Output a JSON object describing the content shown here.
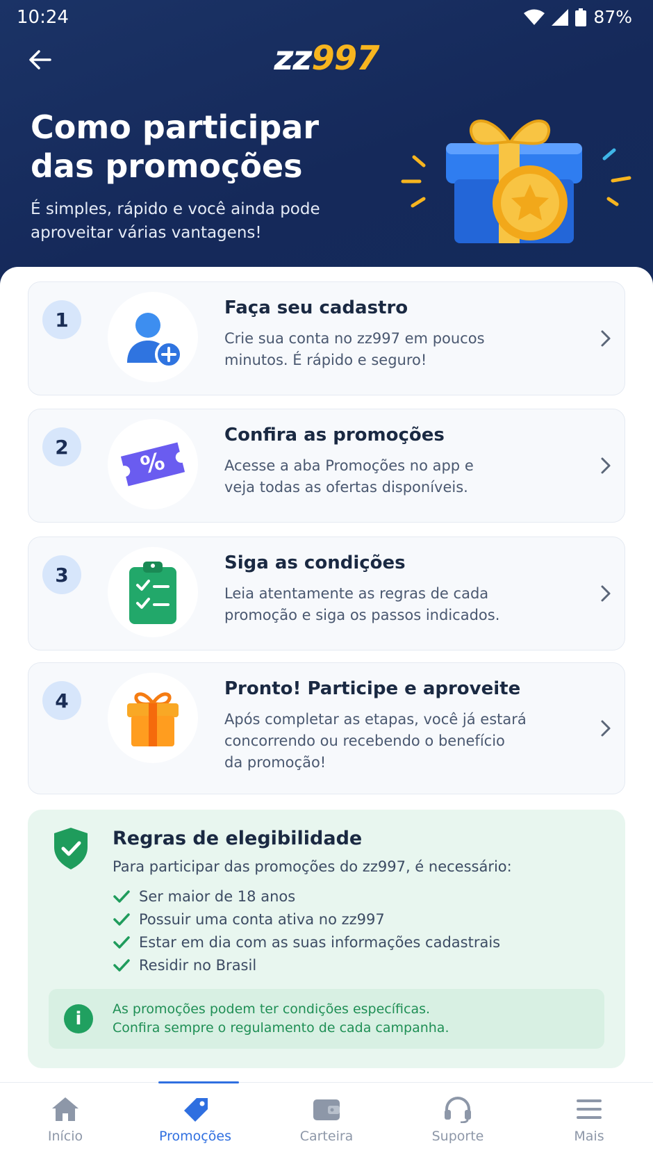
{
  "status_bar": {
    "time": "10:24",
    "battery": "87%"
  },
  "header": {
    "logo_part1": "zz",
    "logo_part2": "997"
  },
  "hero": {
    "title_line1": "Como participar",
    "title_line2": "das promoções",
    "subtitle_line1": "É simples, rápido e você ainda pode",
    "subtitle_line2": "aproveitar várias vantagens!"
  },
  "steps": [
    {
      "number": "1",
      "title": "Faça seu cadastro",
      "desc": [
        "Crie sua conta no zz997 em poucos",
        "minutos. É rápido e seguro!"
      ],
      "icon": "user-add-icon"
    },
    {
      "number": "2",
      "title": "Confira as promoções",
      "desc": [
        "Acesse a aba Promoções no app e",
        "veja todas as ofertas disponíveis."
      ],
      "icon": "ticket-percent-icon"
    },
    {
      "number": "3",
      "title": "Siga as condições",
      "desc": [
        "Leia atentamente as regras de cada",
        "promoção e siga os passos indicados."
      ],
      "icon": "clipboard-check-icon"
    },
    {
      "number": "4",
      "title": "Pronto! Participe e aproveite",
      "desc": [
        "Após completar as etapas, você já estará",
        "concorrendo ou recebendo o benefício",
        "da promoção!"
      ],
      "icon": "gift-icon"
    }
  ],
  "rules": {
    "title": "Regras de elegibilidade",
    "subtitle": "Para participar das promoções do zz997, é necessário:",
    "items": [
      "Ser maior de 18 anos",
      "Possuir uma conta ativa no zz997",
      "Estar em dia com as suas informações cadastrais",
      "Residir no Brasil"
    ],
    "note_line1": "As promoções podem ter condições específicas.",
    "note_line2": "Confira sempre o regulamento de cada campanha."
  },
  "bottom_nav": {
    "items": [
      {
        "label": "Início",
        "icon": "home-icon",
        "active": false
      },
      {
        "label": "Promoções",
        "icon": "tag-icon",
        "active": true
      },
      {
        "label": "Carteira",
        "icon": "wallet-icon",
        "active": false
      },
      {
        "label": "Suporte",
        "icon": "headset-icon",
        "active": false
      },
      {
        "label": "Mais",
        "icon": "menu-icon",
        "active": false
      }
    ]
  },
  "colors": {
    "hero_bg": "#15295a",
    "accent": "#2f6fe0",
    "logo_gold": "#f7b51f",
    "success": "#20a060"
  }
}
